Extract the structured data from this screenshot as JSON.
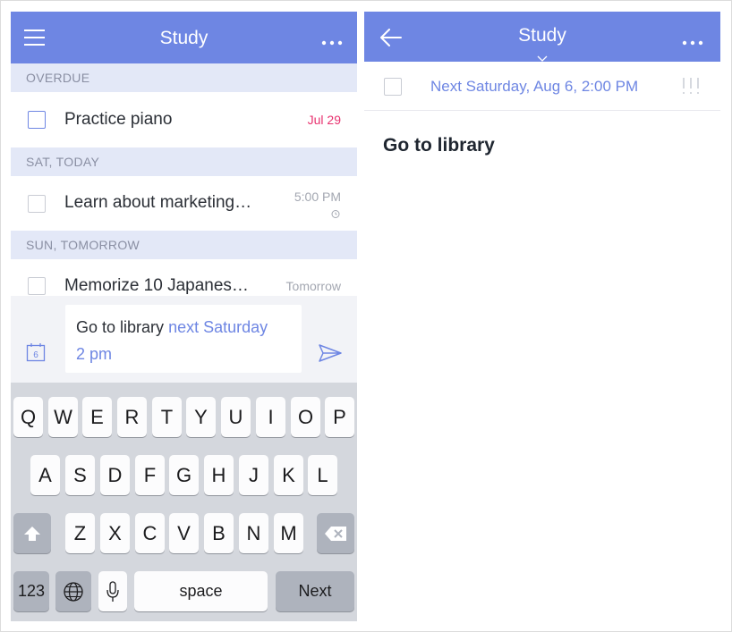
{
  "left": {
    "header": {
      "title": "Study",
      "menu_icon": "hamburger-icon",
      "more_icon": "more-dots-icon"
    },
    "sections": [
      {
        "label": "OVERDUE",
        "tasks": [
          {
            "title": "Practice piano",
            "meta": "Jul 29",
            "meta_color": "#e8326f"
          }
        ]
      },
      {
        "label": "SAT, TODAY",
        "tasks": [
          {
            "title": "Learn about marketing…",
            "meta": "5:00 PM",
            "has_alarm": true
          }
        ]
      },
      {
        "label": "SUN, TOMORROW",
        "tasks": [
          {
            "title": "Memorize 10 Japanes…",
            "meta": "Tomorrow"
          }
        ]
      }
    ],
    "input": {
      "text": "Go to library",
      "highlight_line1": "next Saturday",
      "highlight_line2": "2 pm",
      "calendar_icon": "calendar-icon",
      "calendar_day": "6",
      "send_icon": "send-icon"
    },
    "keyboard": {
      "row1": [
        "Q",
        "W",
        "E",
        "R",
        "T",
        "Y",
        "U",
        "I",
        "O",
        "P"
      ],
      "row2": [
        "A",
        "S",
        "D",
        "F",
        "G",
        "H",
        "J",
        "K",
        "L"
      ],
      "row3": [
        "Z",
        "X",
        "C",
        "V",
        "B",
        "N",
        "M"
      ],
      "numbers_key": "123",
      "space_key": "space",
      "next_key": "Next"
    }
  },
  "right": {
    "header": {
      "title": "Study",
      "back_icon": "back-arrow-icon",
      "more_icon": "more-dots-icon"
    },
    "due_label": "Next Saturday, Aug 6, 2:00 PM",
    "task_title": "Go to library",
    "priority_icon": "priority-icon"
  },
  "colors": {
    "accent": "#6e86e3",
    "overdue": "#e8326f",
    "section_bg": "#e3e8f7"
  }
}
